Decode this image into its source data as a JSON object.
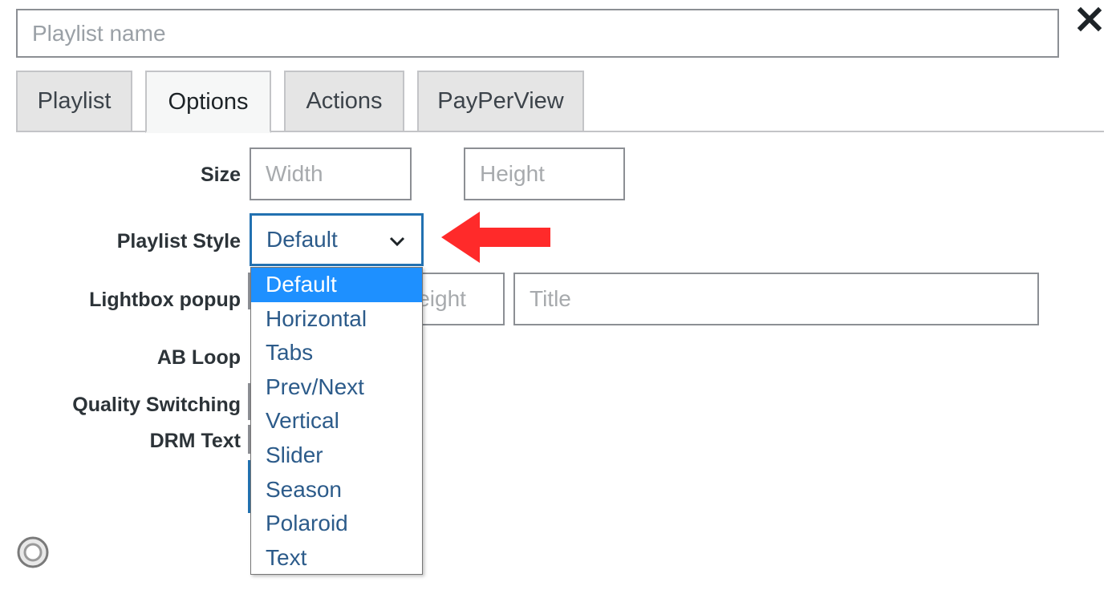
{
  "header": {
    "name_placeholder": "Playlist name",
    "close_icon": "close-icon"
  },
  "tabs": [
    {
      "label": "Playlist",
      "active": false
    },
    {
      "label": "Options",
      "active": true
    },
    {
      "label": "Actions",
      "active": false
    },
    {
      "label": "PayPerView",
      "active": false
    }
  ],
  "options": {
    "size_label": "Size",
    "width_placeholder": "Width",
    "height_placeholder": "Height",
    "playlist_style_label": "Playlist Style",
    "playlist_style_value": "Default",
    "lightbox_label": "Lightbox popup",
    "lightbox_height_placeholder": "Height",
    "lightbox_title_placeholder": "Title",
    "ab_loop_label": "AB Loop",
    "quality_switching_label": "Quality Switching",
    "drm_text_label": "DRM Text"
  },
  "dropdown": {
    "options": [
      "Default",
      "Horizontal",
      "Tabs",
      "Prev/Next",
      "Vertical",
      "Slider",
      "Season",
      "Polaroid",
      "Text"
    ],
    "selected": "Default"
  },
  "colors": {
    "accent": "#2271b1",
    "selected_option_bg": "#1e90ff",
    "annotation_arrow": "#ff2a2a"
  }
}
